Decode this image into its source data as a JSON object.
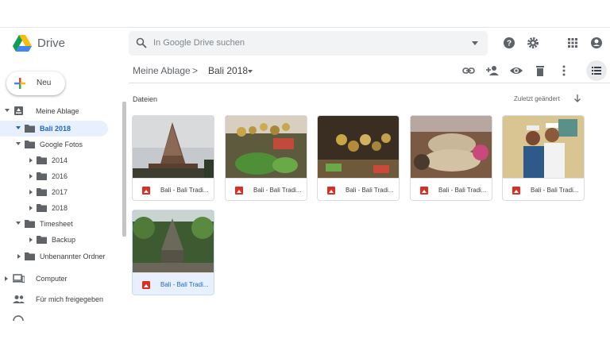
{
  "app": {
    "name": "Drive"
  },
  "search": {
    "placeholder": "In Google Drive suchen"
  },
  "header_icons": [
    "help-icon",
    "settings-icon",
    "apps-grid-icon",
    "account-icon"
  ],
  "sidebar": {
    "new_label": "Neu",
    "items": [
      {
        "label": "Meine Ablage",
        "name": "sidebar-item-meine-ablage"
      },
      {
        "label": "Bali 2018",
        "name": "sidebar-item-bali-2018",
        "selected": true
      },
      {
        "label": "Google Fotos",
        "name": "sidebar-item-google-fotos"
      },
      {
        "label": "2014",
        "name": "sidebar-item-2014"
      },
      {
        "label": "2016",
        "name": "sidebar-item-2016"
      },
      {
        "label": "2017",
        "name": "sidebar-item-2017"
      },
      {
        "label": "2018",
        "name": "sidebar-item-2018"
      },
      {
        "label": "Timesheet",
        "name": "sidebar-item-timesheet"
      },
      {
        "label": "Backup",
        "name": "sidebar-item-backup"
      },
      {
        "label": "Unbenannter Ordner",
        "name": "sidebar-item-unbenannter-ordner"
      },
      {
        "label": "Computer",
        "name": "sidebar-item-computer"
      },
      {
        "label": "Für mich freigegeben",
        "name": "sidebar-item-shared"
      }
    ]
  },
  "breadcrumb": {
    "root": "Meine Ablage",
    "separator": ">",
    "current": "Bali 2018"
  },
  "toolbar_icons": [
    "link-icon",
    "add-person-icon",
    "preview-eye-icon",
    "trash-icon",
    "more-vert-icon",
    "list-view-icon"
  ],
  "files_section": {
    "title": "Dateien",
    "sort_label": "Zuletzt geändert"
  },
  "files": [
    {
      "name": "Bali - Bali Tradi..."
    },
    {
      "name": "Bali - Bali Tradi..."
    },
    {
      "name": "Bali - Bali Tradi..."
    },
    {
      "name": "Bali - Bali Tradi..."
    },
    {
      "name": "Bali - Bali Tradi..."
    },
    {
      "name": "Bali - Bali Tradi...",
      "selected": true
    }
  ],
  "colors": {
    "accent": "#1a73e8",
    "selected_bg": "#e8f0fe",
    "file_icon": "#d93025"
  }
}
